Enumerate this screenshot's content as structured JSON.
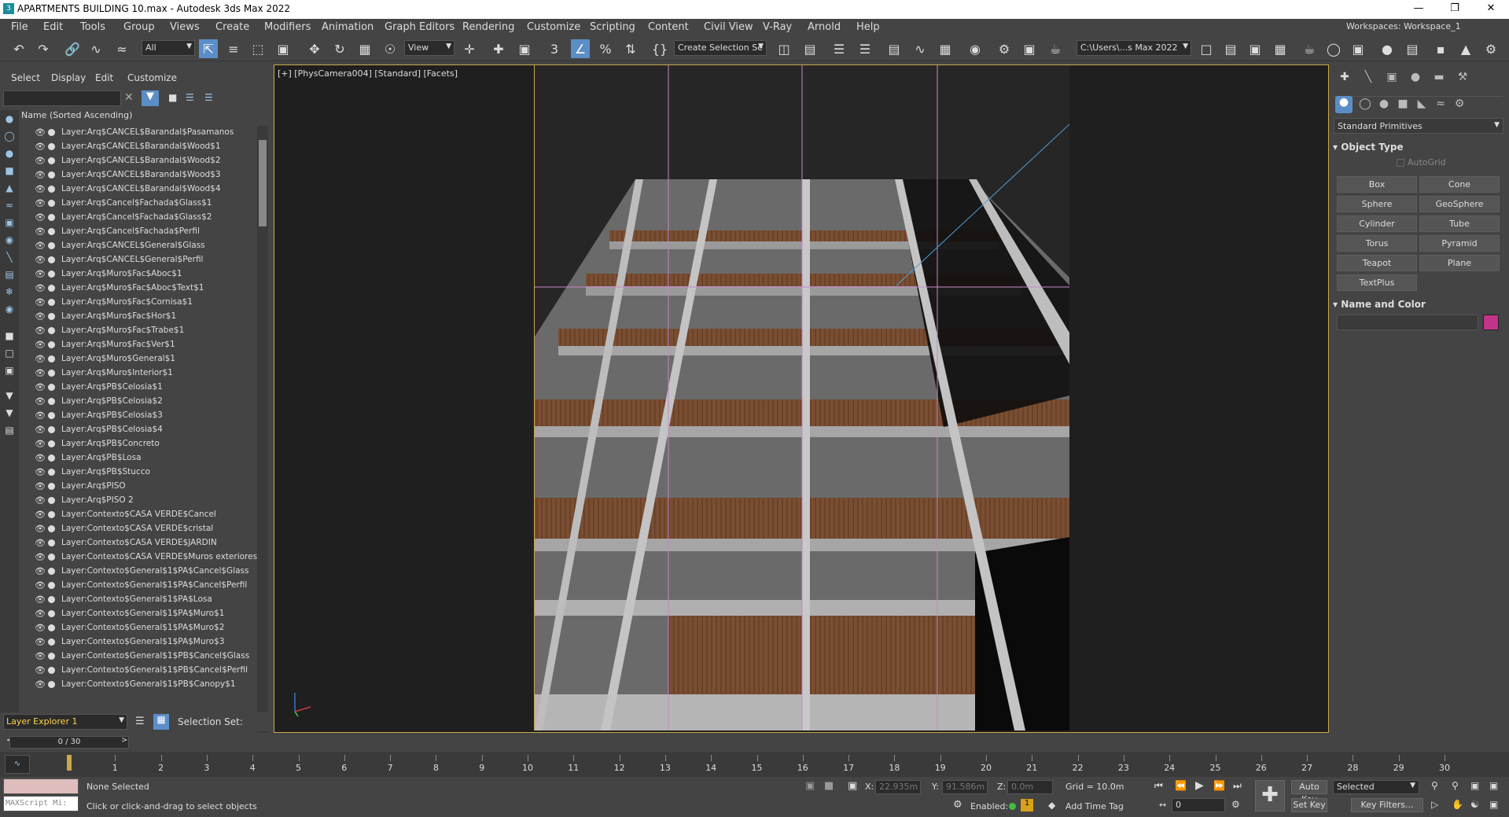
{
  "titlebar": {
    "title": "APARTMENTS BUILDING 10.max - Autodesk 3ds Max 2022"
  },
  "menubar": {
    "items": [
      "File",
      "Edit",
      "Tools",
      "Group",
      "Views",
      "Create",
      "Modifiers",
      "Animation",
      "Graph Editors",
      "Rendering",
      "Customize",
      "Scripting",
      "Content",
      "Civil View",
      "V-Ray",
      "Arnold",
      "Help"
    ]
  },
  "workspace": {
    "label": "Workspaces:",
    "value": "Workspace_1"
  },
  "toolbar": {
    "filter": "All",
    "view": "View",
    "selection_set": "Create Selection Se",
    "path": "C:\\Users\\...s Max 2022"
  },
  "scene_explorer": {
    "menus": [
      "Select",
      "Display",
      "Edit",
      "Customize"
    ],
    "header": "Name (Sorted Ascending)",
    "layers": [
      "Layer:Arq$CANCEL$Barandal$Pasamanos",
      "Layer:Arq$CANCEL$Barandal$Wood$1",
      "Layer:Arq$CANCEL$Barandal$Wood$2",
      "Layer:Arq$CANCEL$Barandal$Wood$3",
      "Layer:Arq$CANCEL$Barandal$Wood$4",
      "Layer:Arq$Cancel$Fachada$Glass$1",
      "Layer:Arq$Cancel$Fachada$Glass$2",
      "Layer:Arq$Cancel$Fachada$Perfil",
      "Layer:Arq$CANCEL$General$Glass",
      "Layer:Arq$CANCEL$General$Perfil",
      "Layer:Arq$Muro$Fac$Aboc$1",
      "Layer:Arq$Muro$Fac$Aboc$Text$1",
      "Layer:Arq$Muro$Fac$Cornisa$1",
      "Layer:Arq$Muro$Fac$Hor$1",
      "Layer:Arq$Muro$Fac$Trabe$1",
      "Layer:Arq$Muro$Fac$Ver$1",
      "Layer:Arq$Muro$General$1",
      "Layer:Arq$Muro$Interior$1",
      "Layer:Arq$PB$Celosia$1",
      "Layer:Arq$PB$Celosia$2",
      "Layer:Arq$PB$Celosia$3",
      "Layer:Arq$PB$Celosia$4",
      "Layer:Arq$PB$Concreto",
      "Layer:Arq$PB$Losa",
      "Layer:Arq$PB$Stucco",
      "Layer:Arq$PISO",
      "Layer:Arq$PISO 2",
      "Layer:Contexto$CASA VERDE$Cancel",
      "Layer:Contexto$CASA VERDE$cristal",
      "Layer:Contexto$CASA VERDE$JARDIN",
      "Layer:Contexto$CASA VERDE$Muros exteriores",
      "Layer:Contexto$General$1$PA$Cancel$Glass",
      "Layer:Contexto$General$1$PA$Cancel$Perfil",
      "Layer:Contexto$General$1$PA$Losa",
      "Layer:Contexto$General$1$PA$Muro$1",
      "Layer:Contexto$General$1$PA$Muro$2",
      "Layer:Contexto$General$1$PA$Muro$3",
      "Layer:Contexto$General$1$PB$Cancel$Glass",
      "Layer:Contexto$General$1$PB$Cancel$Perfil",
      "Layer:Contexto$General$1$PB$Canopy$1"
    ],
    "explorer_name": "Layer Explorer 1",
    "selection_set_label": "Selection Set:"
  },
  "viewport": {
    "label": "[+] [PhysCamera004] [Standard] [Facets]"
  },
  "command_panel": {
    "category": "Standard Primitives",
    "object_type_title": "Object Type",
    "autogrid": "AutoGrid",
    "buttons": [
      "Box",
      "Cone",
      "Sphere",
      "GeoSphere",
      "Cylinder",
      "Tube",
      "Torus",
      "Pyramid",
      "Teapot",
      "Plane",
      "TextPlus"
    ],
    "name_color_title": "Name and Color",
    "swatch_color": "#c2338a"
  },
  "timeline": {
    "frame": "0 / 30",
    "ticks": [
      "0",
      "1",
      "2",
      "3",
      "4",
      "5",
      "6",
      "7",
      "8",
      "9",
      "10",
      "11",
      "12",
      "13",
      "14",
      "15",
      "16",
      "17",
      "18",
      "19",
      "20",
      "21",
      "22",
      "23",
      "24",
      "25",
      "26",
      "27",
      "28",
      "29",
      "30"
    ]
  },
  "status": {
    "script_label": "MAXScript Mi:",
    "selection": "None Selected",
    "prompt": "Click or click-and-drag to select objects",
    "x_label": "X:",
    "x": "22.935m",
    "y_label": "Y:",
    "y": "91.586m",
    "z_label": "Z:",
    "z": "0.0m",
    "grid": "Grid = 10.0m",
    "enabled": "Enabled:",
    "add_time_tag": "Add Time Tag",
    "auto_key": "Auto Key",
    "set_key": "Set Key",
    "selected": "Selected",
    "key_filters": "Key Filters...",
    "frame_field": "0"
  }
}
